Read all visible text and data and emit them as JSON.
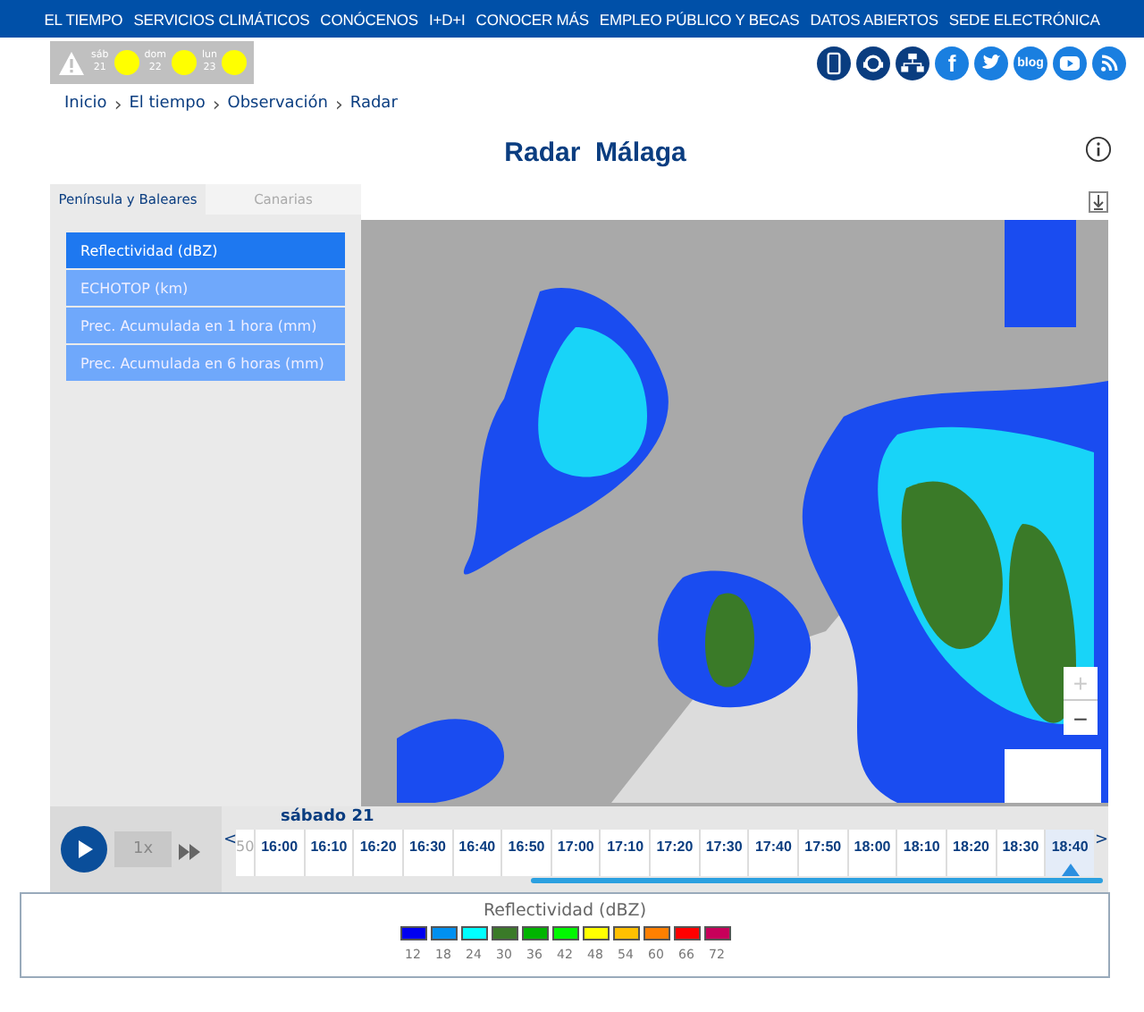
{
  "nav": [
    "EL TIEMPO",
    "SERVICIOS CLIMÁTICOS",
    "CONÓCENOS",
    "I+D+I",
    "CONOCER MÁS",
    "EMPLEO PÚBLICO Y BECAS",
    "DATOS ABIERTOS",
    "SEDE ELECTRÓNICA"
  ],
  "warnings": [
    {
      "day": "sáb",
      "date": "21",
      "color": "#ffff00"
    },
    {
      "day": "dom",
      "date": "22",
      "color": "#ffff00"
    },
    {
      "day": "lun",
      "date": "23",
      "color": "#ffff00"
    }
  ],
  "social": [
    {
      "kind": "mobile"
    },
    {
      "kind": "headset"
    },
    {
      "kind": "network"
    },
    {
      "kind": "facebook",
      "label": "f"
    },
    {
      "kind": "twitter"
    },
    {
      "kind": "blog",
      "label": "blog"
    },
    {
      "kind": "youtube"
    },
    {
      "kind": "rss"
    }
  ],
  "breadcrumb": [
    {
      "kind": "link",
      "label": "Inicio"
    },
    {
      "kind": "separator",
      "label": "›"
    },
    {
      "kind": "link",
      "label": "El tiempo"
    },
    {
      "kind": "separator",
      "label": "›"
    },
    {
      "kind": "link",
      "label": "Observación"
    },
    {
      "kind": "separator",
      "label": "›"
    },
    {
      "kind": "link",
      "label": "Radar"
    }
  ],
  "title": "Radar  Málaga",
  "region_tabs": [
    {
      "label": "Península y Baleares",
      "selected": true
    },
    {
      "label": "Canarias",
      "selected": false
    }
  ],
  "products": [
    {
      "label": "Reflectividad (dBZ)",
      "selected": true
    },
    {
      "label": "ECHOTOP (km)",
      "selected": false
    },
    {
      "label": "Prec. Acumulada en 1 hora (mm)",
      "selected": false
    },
    {
      "label": "Prec. Acumulada en 6 horas (mm)",
      "selected": false
    }
  ],
  "map_zoom": [
    "+",
    "−"
  ],
  "player": {
    "speed": "1x"
  },
  "timeline": {
    "day": "sábado 21",
    "prev": "<",
    "next": ">",
    "partial": "50",
    "progress": {
      "level": 0.66
    },
    "times": [
      {
        "label": "16:00",
        "selected": false
      },
      {
        "label": "16:10",
        "selected": false
      },
      {
        "label": "16:20",
        "selected": false
      },
      {
        "label": "16:30",
        "selected": false
      },
      {
        "label": "16:40",
        "selected": false
      },
      {
        "label": "16:50",
        "selected": false
      },
      {
        "label": "17:00",
        "selected": false
      },
      {
        "label": "17:10",
        "selected": false
      },
      {
        "label": "17:20",
        "selected": false
      },
      {
        "label": "17:30",
        "selected": false
      },
      {
        "label": "17:40",
        "selected": false
      },
      {
        "label": "17:50",
        "selected": false
      },
      {
        "label": "18:00",
        "selected": false
      },
      {
        "label": "18:10",
        "selected": false
      },
      {
        "label": "18:20",
        "selected": false
      },
      {
        "label": "18:30",
        "selected": false
      },
      {
        "label": "18:40",
        "selected": true
      }
    ]
  },
  "legend": {
    "title": "Reflectividad (dBZ)",
    "items": [
      {
        "label": "12",
        "color": "#0000f0"
      },
      {
        "label": "18",
        "color": "#0090f0"
      },
      {
        "label": "24",
        "color": "#00ffff"
      },
      {
        "label": "30",
        "color": "#3a7a28"
      },
      {
        "label": "36",
        "color": "#00b400"
      },
      {
        "label": "42",
        "color": "#00f800"
      },
      {
        "label": "48",
        "color": "#ffff00"
      },
      {
        "label": "54",
        "color": "#ffc000"
      },
      {
        "label": "60",
        "color": "#ff8000"
      },
      {
        "label": "66",
        "color": "#ff0000"
      },
      {
        "label": "72",
        "color": "#c8005a"
      }
    ]
  }
}
